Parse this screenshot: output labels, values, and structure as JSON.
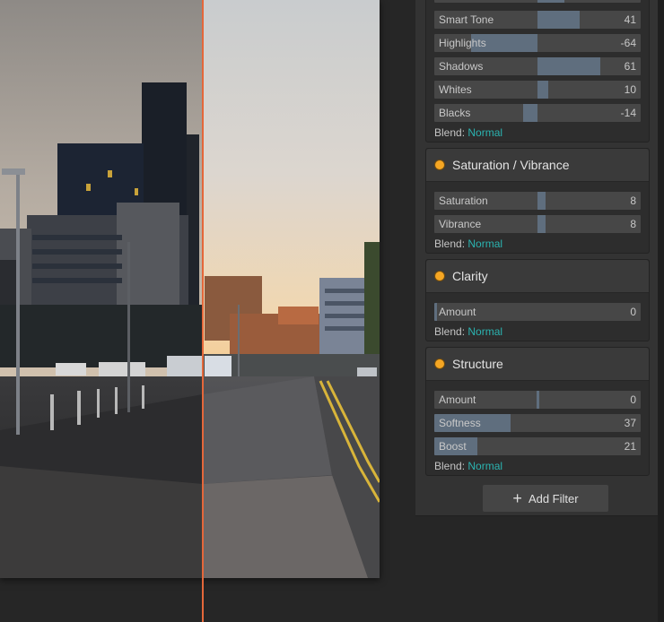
{
  "tone_section": {
    "sliders": [
      {
        "label": "Smart Tone",
        "value": "41",
        "amount": 0.41
      },
      {
        "label": "Highlights",
        "value": "-64",
        "amount": -0.64
      },
      {
        "label": "Shadows",
        "value": "61",
        "amount": 0.61
      },
      {
        "label": "Whites",
        "value": "10",
        "amount": 0.1
      },
      {
        "label": "Blacks",
        "value": "-14",
        "amount": -0.14
      }
    ],
    "blend_label": "Blend:",
    "blend_mode": "Normal"
  },
  "saturation_section": {
    "title": "Saturation / Vibrance",
    "sliders": [
      {
        "label": "Saturation",
        "value": "8",
        "amount": 0.08
      },
      {
        "label": "Vibrance",
        "value": "8",
        "amount": 0.08
      }
    ],
    "blend_label": "Blend:",
    "blend_mode": "Normal"
  },
  "clarity_section": {
    "title": "Clarity",
    "sliders": [
      {
        "label": "Amount",
        "value": "0",
        "amount": 0
      }
    ],
    "blend_label": "Blend:",
    "blend_mode": "Normal"
  },
  "structure_section": {
    "title": "Structure",
    "sliders": [
      {
        "label": "Amount",
        "value": "0",
        "amount": 0
      },
      {
        "label": "Softness",
        "value": "37",
        "amount": 0.37
      },
      {
        "label": "Boost",
        "value": "21",
        "amount": 0.21
      }
    ],
    "blend_label": "Blend:",
    "blend_mode": "Normal"
  },
  "add_filter_label": "Add Filter",
  "colors": {
    "accent_dot": "#f5a623",
    "blend_mode": "#2bb3b0",
    "split_line": "#e4673a",
    "slider_fill": "#5f6e7e"
  }
}
